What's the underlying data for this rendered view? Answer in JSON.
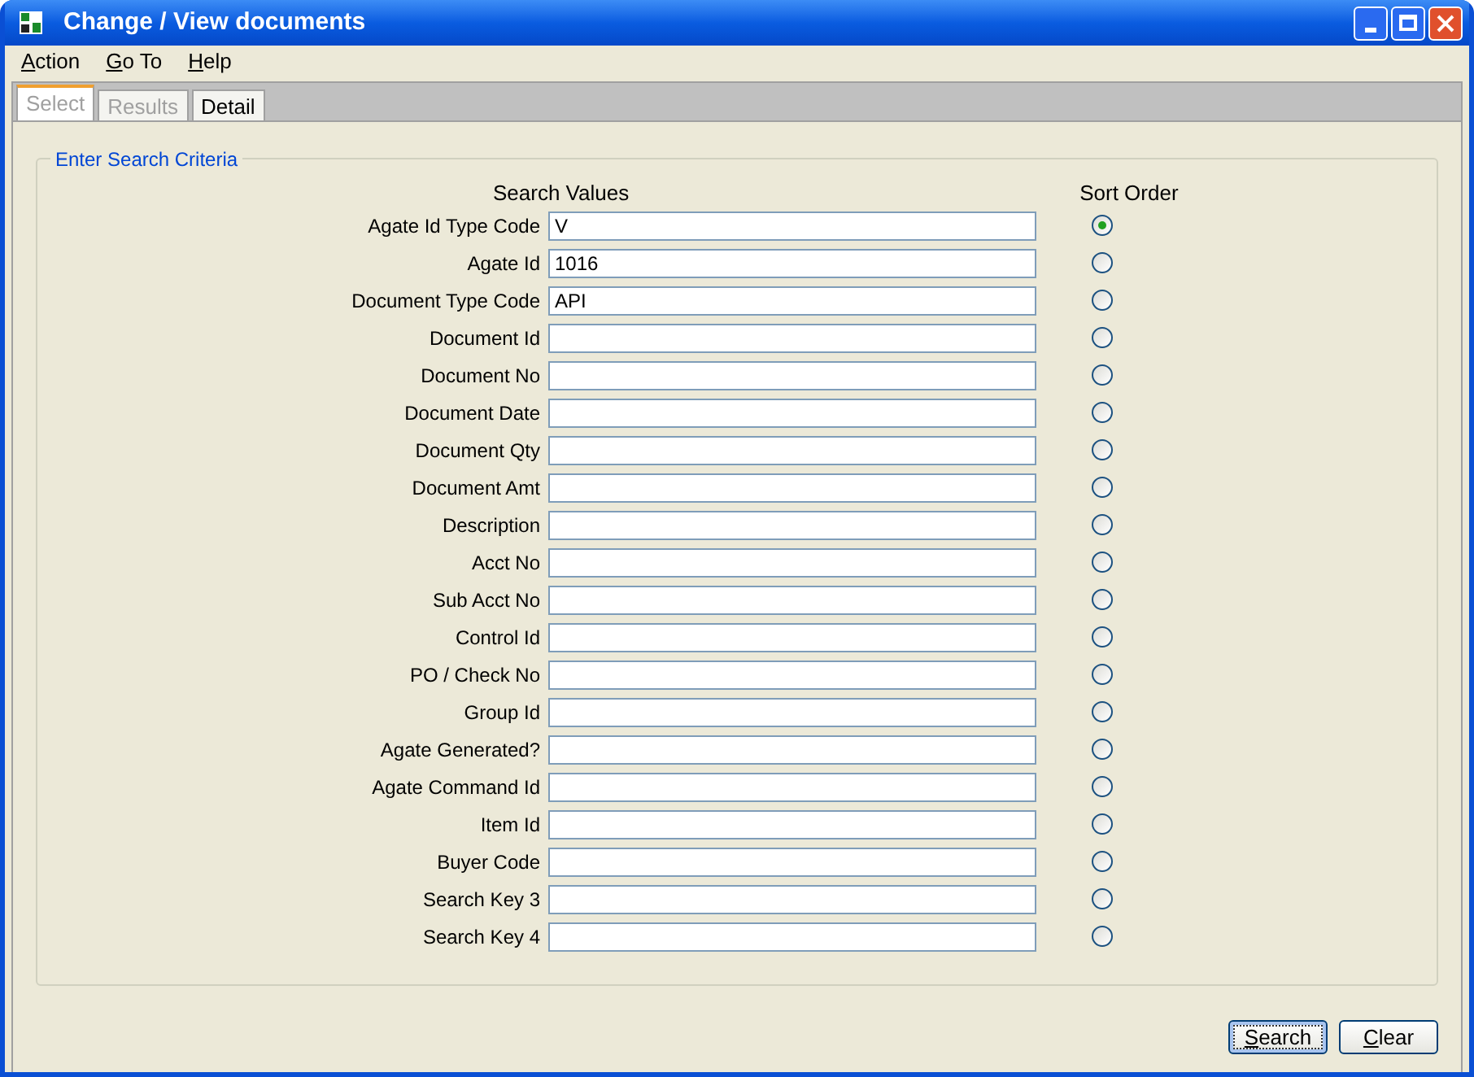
{
  "window": {
    "title": "Change / View documents"
  },
  "menu": [
    {
      "label": "Action"
    },
    {
      "label": "Go To"
    },
    {
      "label": "Help"
    }
  ],
  "tabs": [
    {
      "label": "Select",
      "selected": true,
      "disabled": true
    },
    {
      "label": "Results",
      "selected": false,
      "disabled": true
    },
    {
      "label": "Detail",
      "selected": false,
      "disabled": false
    }
  ],
  "group": {
    "title": "Enter Search Criteria",
    "values_heading": "Search Values",
    "sort_heading": "Sort Order"
  },
  "fields": [
    {
      "label": "Agate Id Type Code",
      "value": "V",
      "selected": true
    },
    {
      "label": "Agate Id",
      "value": "1016",
      "selected": false
    },
    {
      "label": "Document Type Code",
      "value": "API",
      "selected": false
    },
    {
      "label": "Document Id",
      "selected": false
    },
    {
      "label": "Document No",
      "selected": false
    },
    {
      "label": "Document Date",
      "selected": false
    },
    {
      "label": "Document Qty",
      "selected": false
    },
    {
      "label": "Document Amt",
      "selected": false
    },
    {
      "label": "Description",
      "selected": false
    },
    {
      "label": "Acct No",
      "selected": false
    },
    {
      "label": "Sub Acct No",
      "selected": false
    },
    {
      "label": "Control Id",
      "selected": false
    },
    {
      "label": "PO / Check No",
      "selected": false
    },
    {
      "label": "Group Id",
      "selected": false
    },
    {
      "label": "Agate Generated?",
      "selected": false
    },
    {
      "label": "Agate Command Id",
      "selected": false
    },
    {
      "label": "Item Id",
      "selected": false
    },
    {
      "label": "Buyer Code",
      "selected": false
    },
    {
      "label": "Search Key 3",
      "selected": false
    },
    {
      "label": "Search Key 4",
      "selected": false
    }
  ],
  "buttons": [
    {
      "label": "Search",
      "selected": true
    },
    {
      "label": "Clear",
      "selected": false
    }
  ]
}
